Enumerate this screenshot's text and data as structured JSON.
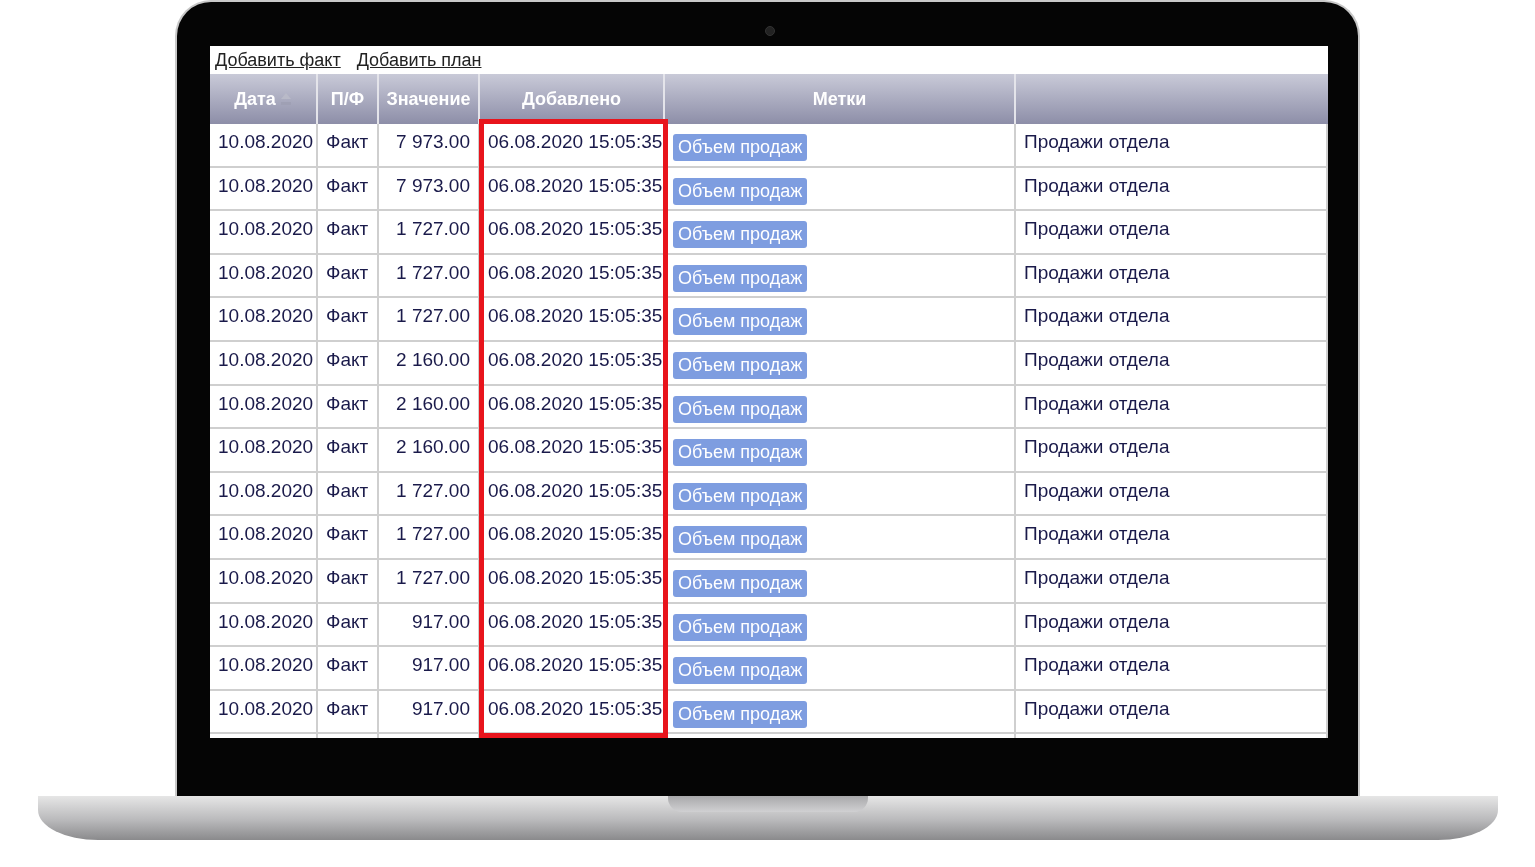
{
  "links": [
    "Добавить факт",
    "Добавить план"
  ],
  "table": {
    "columns": [
      {
        "label": "Дата",
        "sorted": true,
        "highlighted": false
      },
      {
        "label": "П/Ф",
        "sorted": false,
        "highlighted": false
      },
      {
        "label": "Значение",
        "sorted": false,
        "highlighted": false
      },
      {
        "label": "Добавлено",
        "sorted": false,
        "highlighted": true
      },
      {
        "label": "Метки",
        "sorted": false,
        "highlighted": false
      },
      {
        "sorted": false,
        "highlighted": false
      }
    ],
    "rows": [
      {
        "date": "10.08.2020",
        "type": "Факт",
        "value": "7 973.00",
        "added": "06.08.2020 15:05:35",
        "tag": "Объем продаж",
        "note": "Продажи отдела"
      },
      {
        "date": "10.08.2020",
        "type": "Факт",
        "value": "7 973.00",
        "added": "06.08.2020 15:05:35",
        "tag": "Объем продаж",
        "note": "Продажи отдела"
      },
      {
        "date": "10.08.2020",
        "type": "Факт",
        "value": "1 727.00",
        "added": "06.08.2020 15:05:35",
        "tag": "Объем продаж",
        "note": "Продажи отдела"
      },
      {
        "date": "10.08.2020",
        "type": "Факт",
        "value": "1 727.00",
        "added": "06.08.2020 15:05:35",
        "tag": "Объем продаж",
        "note": "Продажи отдела"
      },
      {
        "date": "10.08.2020",
        "type": "Факт",
        "value": "1 727.00",
        "added": "06.08.2020 15:05:35",
        "tag": "Объем продаж",
        "note": "Продажи отдела"
      },
      {
        "date": "10.08.2020",
        "type": "Факт",
        "value": "2 160.00",
        "added": "06.08.2020 15:05:35",
        "tag": "Объем продаж",
        "note": "Продажи отдела"
      },
      {
        "date": "10.08.2020",
        "type": "Факт",
        "value": "2 160.00",
        "added": "06.08.2020 15:05:35",
        "tag": "Объем продаж",
        "note": "Продажи отдела"
      },
      {
        "date": "10.08.2020",
        "type": "Факт",
        "value": "2 160.00",
        "added": "06.08.2020 15:05:35",
        "tag": "Объем продаж",
        "note": "Продажи отдела"
      },
      {
        "date": "10.08.2020",
        "type": "Факт",
        "value": "1 727.00",
        "added": "06.08.2020 15:05:35",
        "tag": "Объем продаж",
        "note": "Продажи отдела"
      },
      {
        "date": "10.08.2020",
        "type": "Факт",
        "value": "1 727.00",
        "added": "06.08.2020 15:05:35",
        "tag": "Объем продаж",
        "note": "Продажи отдела"
      },
      {
        "date": "10.08.2020",
        "type": "Факт",
        "value": "1 727.00",
        "added": "06.08.2020 15:05:35",
        "tag": "Объем продаж",
        "note": "Продажи отдела"
      },
      {
        "date": "10.08.2020",
        "type": "Факт",
        "value": "917.00",
        "added": "06.08.2020 15:05:35",
        "tag": "Объем продаж",
        "note": "Продажи отдела"
      },
      {
        "date": "10.08.2020",
        "type": "Факт",
        "value": "917.00",
        "added": "06.08.2020 15:05:35",
        "tag": "Объем продаж",
        "note": "Продажи отдела"
      },
      {
        "date": "10.08.2020",
        "type": "Факт",
        "value": "917.00",
        "added": "06.08.2020 15:05:35",
        "tag": "Объем продаж",
        "note": "Продажи отдела"
      }
    ]
  }
}
